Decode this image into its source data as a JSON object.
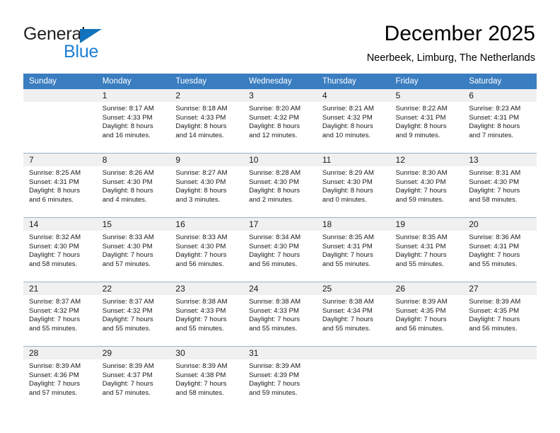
{
  "logo": {
    "word_one": "General",
    "word_two": "Blue",
    "triangle_icon": "blue-triangle-icon",
    "colors": {
      "general": "#231f20",
      "blue": "#1c7fd4",
      "triangle": "#1272bb"
    }
  },
  "header": {
    "title": "December 2025",
    "subtitle": "Neerbeek, Limburg, The Netherlands"
  },
  "colors": {
    "header_row_bg": "#3a7dc0",
    "header_row_text": "#ffffff",
    "daynum_band_bg": "#f0f0f0",
    "row_divider": "#9ab3cc",
    "body_text": "#1a1a1a"
  },
  "calendar": {
    "weekday_headers": [
      "Sunday",
      "Monday",
      "Tuesday",
      "Wednesday",
      "Thursday",
      "Friday",
      "Saturday"
    ],
    "weeks": [
      [
        {
          "day": "",
          "lines": []
        },
        {
          "day": "1",
          "lines": [
            "Sunrise: 8:17 AM",
            "Sunset: 4:33 PM",
            "Daylight: 8 hours",
            "and 16 minutes."
          ]
        },
        {
          "day": "2",
          "lines": [
            "Sunrise: 8:18 AM",
            "Sunset: 4:33 PM",
            "Daylight: 8 hours",
            "and 14 minutes."
          ]
        },
        {
          "day": "3",
          "lines": [
            "Sunrise: 8:20 AM",
            "Sunset: 4:32 PM",
            "Daylight: 8 hours",
            "and 12 minutes."
          ]
        },
        {
          "day": "4",
          "lines": [
            "Sunrise: 8:21 AM",
            "Sunset: 4:32 PM",
            "Daylight: 8 hours",
            "and 10 minutes."
          ]
        },
        {
          "day": "5",
          "lines": [
            "Sunrise: 8:22 AM",
            "Sunset: 4:31 PM",
            "Daylight: 8 hours",
            "and 9 minutes."
          ]
        },
        {
          "day": "6",
          "lines": [
            "Sunrise: 8:23 AM",
            "Sunset: 4:31 PM",
            "Daylight: 8 hours",
            "and 7 minutes."
          ]
        }
      ],
      [
        {
          "day": "7",
          "lines": [
            "Sunrise: 8:25 AM",
            "Sunset: 4:31 PM",
            "Daylight: 8 hours",
            "and 6 minutes."
          ]
        },
        {
          "day": "8",
          "lines": [
            "Sunrise: 8:26 AM",
            "Sunset: 4:30 PM",
            "Daylight: 8 hours",
            "and 4 minutes."
          ]
        },
        {
          "day": "9",
          "lines": [
            "Sunrise: 8:27 AM",
            "Sunset: 4:30 PM",
            "Daylight: 8 hours",
            "and 3 minutes."
          ]
        },
        {
          "day": "10",
          "lines": [
            "Sunrise: 8:28 AM",
            "Sunset: 4:30 PM",
            "Daylight: 8 hours",
            "and 2 minutes."
          ]
        },
        {
          "day": "11",
          "lines": [
            "Sunrise: 8:29 AM",
            "Sunset: 4:30 PM",
            "Daylight: 8 hours",
            "and 0 minutes."
          ]
        },
        {
          "day": "12",
          "lines": [
            "Sunrise: 8:30 AM",
            "Sunset: 4:30 PM",
            "Daylight: 7 hours",
            "and 59 minutes."
          ]
        },
        {
          "day": "13",
          "lines": [
            "Sunrise: 8:31 AM",
            "Sunset: 4:30 PM",
            "Daylight: 7 hours",
            "and 58 minutes."
          ]
        }
      ],
      [
        {
          "day": "14",
          "lines": [
            "Sunrise: 8:32 AM",
            "Sunset: 4:30 PM",
            "Daylight: 7 hours",
            "and 58 minutes."
          ]
        },
        {
          "day": "15",
          "lines": [
            "Sunrise: 8:33 AM",
            "Sunset: 4:30 PM",
            "Daylight: 7 hours",
            "and 57 minutes."
          ]
        },
        {
          "day": "16",
          "lines": [
            "Sunrise: 8:33 AM",
            "Sunset: 4:30 PM",
            "Daylight: 7 hours",
            "and 56 minutes."
          ]
        },
        {
          "day": "17",
          "lines": [
            "Sunrise: 8:34 AM",
            "Sunset: 4:30 PM",
            "Daylight: 7 hours",
            "and 56 minutes."
          ]
        },
        {
          "day": "18",
          "lines": [
            "Sunrise: 8:35 AM",
            "Sunset: 4:31 PM",
            "Daylight: 7 hours",
            "and 55 minutes."
          ]
        },
        {
          "day": "19",
          "lines": [
            "Sunrise: 8:35 AM",
            "Sunset: 4:31 PM",
            "Daylight: 7 hours",
            "and 55 minutes."
          ]
        },
        {
          "day": "20",
          "lines": [
            "Sunrise: 8:36 AM",
            "Sunset: 4:31 PM",
            "Daylight: 7 hours",
            "and 55 minutes."
          ]
        }
      ],
      [
        {
          "day": "21",
          "lines": [
            "Sunrise: 8:37 AM",
            "Sunset: 4:32 PM",
            "Daylight: 7 hours",
            "and 55 minutes."
          ]
        },
        {
          "day": "22",
          "lines": [
            "Sunrise: 8:37 AM",
            "Sunset: 4:32 PM",
            "Daylight: 7 hours",
            "and 55 minutes."
          ]
        },
        {
          "day": "23",
          "lines": [
            "Sunrise: 8:38 AM",
            "Sunset: 4:33 PM",
            "Daylight: 7 hours",
            "and 55 minutes."
          ]
        },
        {
          "day": "24",
          "lines": [
            "Sunrise: 8:38 AM",
            "Sunset: 4:33 PM",
            "Daylight: 7 hours",
            "and 55 minutes."
          ]
        },
        {
          "day": "25",
          "lines": [
            "Sunrise: 8:38 AM",
            "Sunset: 4:34 PM",
            "Daylight: 7 hours",
            "and 55 minutes."
          ]
        },
        {
          "day": "26",
          "lines": [
            "Sunrise: 8:39 AM",
            "Sunset: 4:35 PM",
            "Daylight: 7 hours",
            "and 56 minutes."
          ]
        },
        {
          "day": "27",
          "lines": [
            "Sunrise: 8:39 AM",
            "Sunset: 4:35 PM",
            "Daylight: 7 hours",
            "and 56 minutes."
          ]
        }
      ],
      [
        {
          "day": "28",
          "lines": [
            "Sunrise: 8:39 AM",
            "Sunset: 4:36 PM",
            "Daylight: 7 hours",
            "and 57 minutes."
          ]
        },
        {
          "day": "29",
          "lines": [
            "Sunrise: 8:39 AM",
            "Sunset: 4:37 PM",
            "Daylight: 7 hours",
            "and 57 minutes."
          ]
        },
        {
          "day": "30",
          "lines": [
            "Sunrise: 8:39 AM",
            "Sunset: 4:38 PM",
            "Daylight: 7 hours",
            "and 58 minutes."
          ]
        },
        {
          "day": "31",
          "lines": [
            "Sunrise: 8:39 AM",
            "Sunset: 4:39 PM",
            "Daylight: 7 hours",
            "and 59 minutes."
          ]
        },
        {
          "day": "",
          "lines": []
        },
        {
          "day": "",
          "lines": []
        },
        {
          "day": "",
          "lines": []
        }
      ]
    ]
  }
}
